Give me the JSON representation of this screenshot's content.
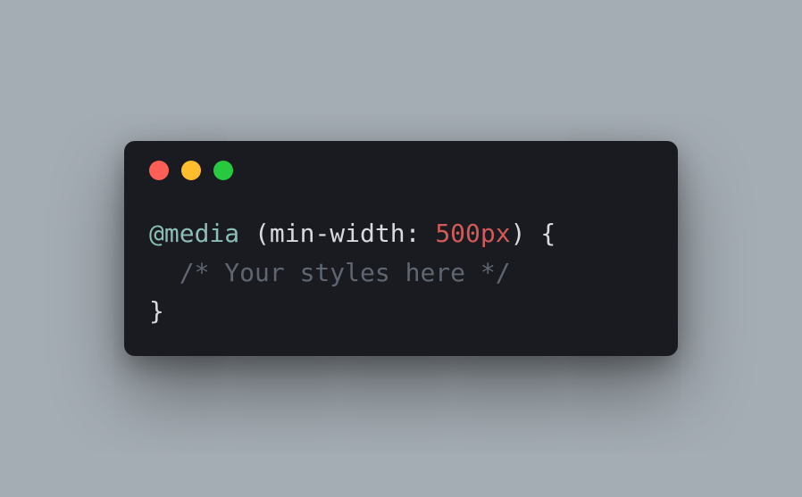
{
  "code": {
    "line1": {
      "keyword": "@media",
      "space1": " ",
      "paren_open": "(",
      "property": "min-width",
      "colon": ":",
      "space2": " ",
      "value": "500px",
      "paren_close": ")",
      "space3": " ",
      "brace_open": "{"
    },
    "line2": {
      "indent": "  ",
      "comment": "/* Your styles here */"
    },
    "line3": {
      "brace_close": "}"
    }
  }
}
